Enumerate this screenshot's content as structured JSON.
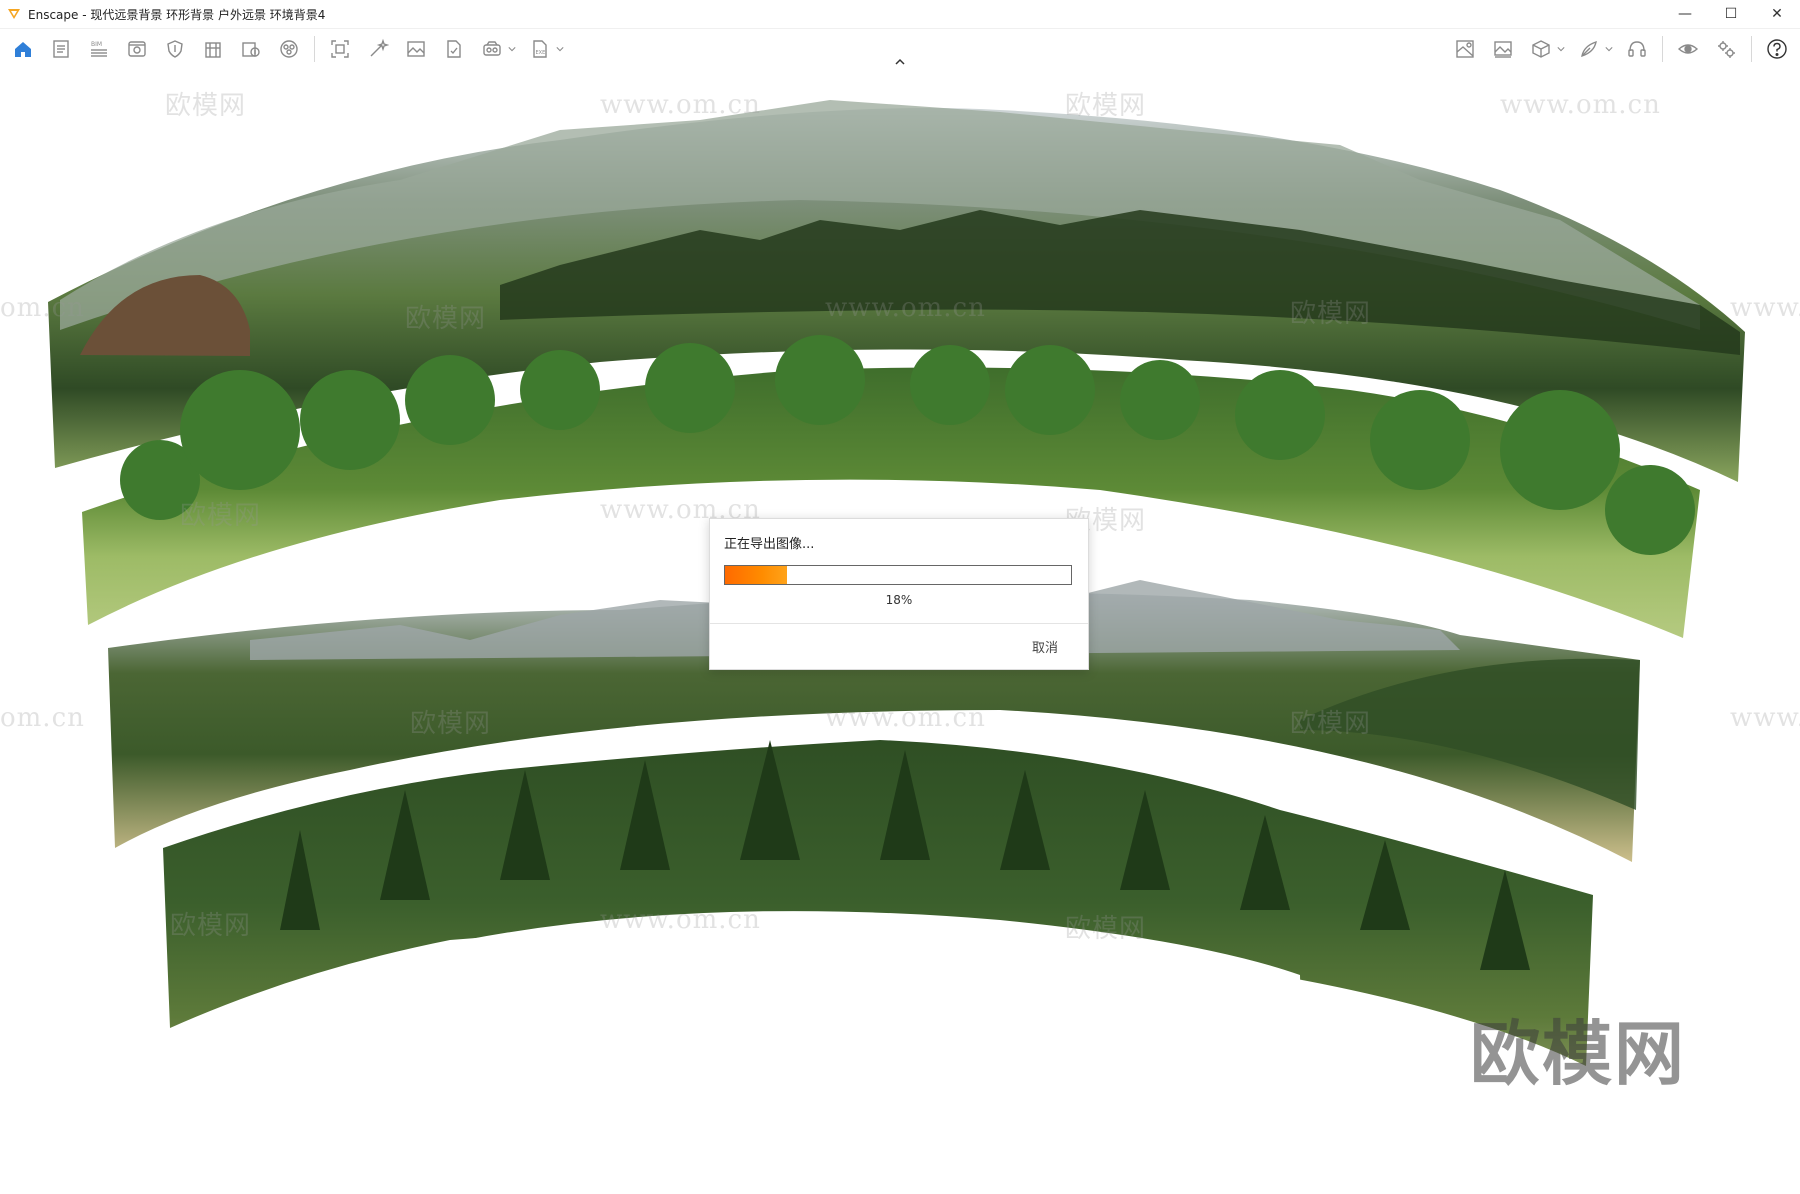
{
  "app": {
    "name": "Enscape",
    "title": "Enscape - 现代远景背景 环形背景 户外远景 环境背景4",
    "accent_color": "#f5a623"
  },
  "window_controls": {
    "minimize": "—",
    "maximize": "☐",
    "close": "✕"
  },
  "toolbar": {
    "left_icons": [
      "home-icon",
      "document-icon",
      "bim-icon",
      "view-icon",
      "shield-icon",
      "building-icon",
      "export-icon",
      "sphere-icon",
      "capture-icon",
      "wand-icon",
      "image-icon",
      "file-check-icon",
      "vr-icon",
      "panorama-export-icon"
    ],
    "right_icons": [
      "asset-library-icon",
      "image-gallery-icon",
      "cube-icon",
      "material-icon",
      "headset-icon",
      "eye-icon",
      "settings-icon",
      "help-icon"
    ],
    "collapse": "^"
  },
  "watermarks": {
    "brand": "欧模网",
    "url": "www.om.cn",
    "url_fragment": "om.cn",
    "url_prefix": "www."
  },
  "dialog": {
    "title": "正在导出图像...",
    "progress": 0.18,
    "progress_label": "18%",
    "cancel_label": "取消"
  }
}
